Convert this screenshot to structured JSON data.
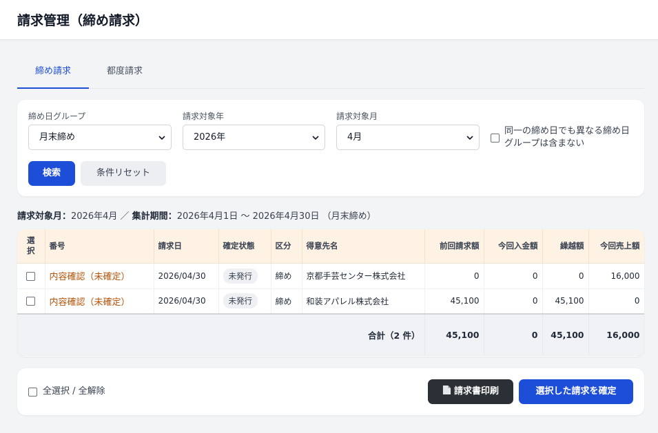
{
  "header": {
    "title": "請求管理（締め請求）"
  },
  "tabs": [
    {
      "label": "締め請求"
    },
    {
      "label": "都度請求"
    }
  ],
  "filters": {
    "group_label": "締め日グループ",
    "group_value": "月末締め",
    "year_label": "請求対象年",
    "year_value": "2026年",
    "month_label": "請求対象月",
    "month_value": "4月",
    "exclude_label": "同一の締め日でも異なる締め日グループは含まない",
    "search_label": "検索",
    "reset_label": "条件リセット"
  },
  "summary": {
    "month_label": "請求対象月：",
    "month_value": "2026年4月",
    "separator": "／",
    "period_label": "集計期間：",
    "period_value": "2026年4月1日 〜 2026年4月30日 （月末締め）"
  },
  "table": {
    "columns": [
      "選択",
      "番号",
      "請求日",
      "確定状態",
      "区分",
      "得意先名",
      "前回請求額",
      "今回入金額",
      "繰越額",
      "今回売上額"
    ],
    "rows": [
      {
        "number": "内容確認（未確定）",
        "date": "2026/04/30",
        "status": "未発行",
        "type": "締め",
        "customer": "京都手芸センター株式会社",
        "prev": "0",
        "paid": "0",
        "carry": "0",
        "sales": "16,000"
      },
      {
        "number": "内容確認（未確定）",
        "date": "2026/04/30",
        "status": "未発行",
        "type": "締め",
        "customer": "和装アパレル株式会社",
        "prev": "45,100",
        "paid": "0",
        "carry": "45,100",
        "sales": "0"
      }
    ],
    "total": {
      "label": "合計（2 件）",
      "prev": "45,100",
      "paid": "0",
      "carry": "45,100",
      "sales": "16,000"
    }
  },
  "footer": {
    "select_all_label": "全選択 / 全解除",
    "print_label": "請求書印刷",
    "confirm_label": "選択した請求を確定"
  },
  "colors": {
    "primary": "#1d4ed8",
    "dark": "#2b2f36",
    "link": "#b45309",
    "header_bg": "#fdf2e4"
  }
}
